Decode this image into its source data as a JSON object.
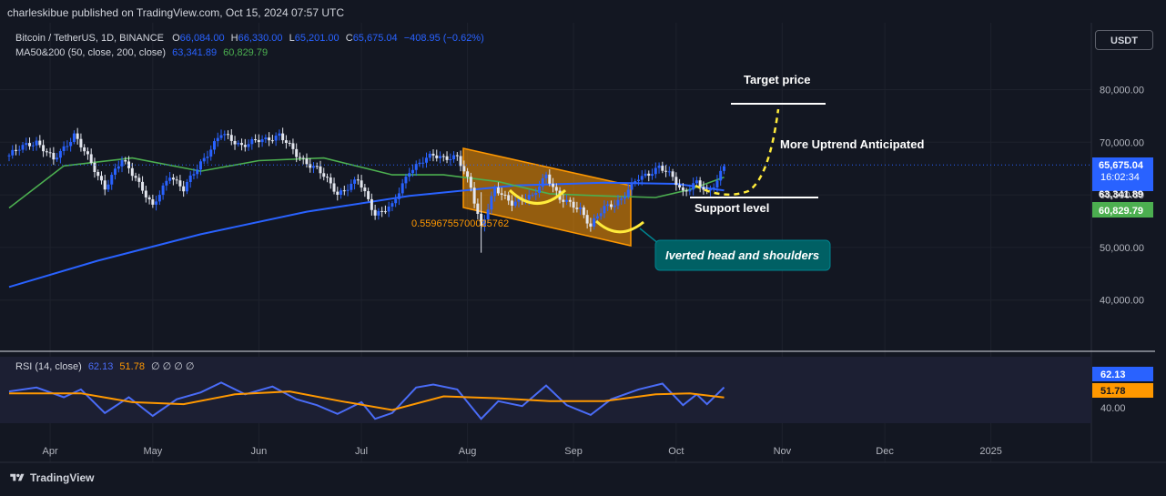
{
  "header": {
    "publisher": "charleskibue published on TradingView.com, Oct 15, 2024 07:57 UTC"
  },
  "legend": {
    "symbol": "Bitcoin / TetherUS, 1D, BINANCE",
    "open_k": "O",
    "open_v": "66,084.00",
    "high_k": "H",
    "high_v": "66,330.00",
    "low_k": "L",
    "low_v": "65,201.00",
    "close_k": "C",
    "close_v": "65,675.04",
    "change": "−408.95 (−0.62%)",
    "ma_label": "MA50&200 (50, close, 200, close)",
    "ma50_value": "63,341.89",
    "ma200_value": "60,829.79",
    "rsi_label": "RSI (14, close)",
    "rsi_value": "62.13",
    "rsi_ma_value": "51.78",
    "rsi_extra": "∅ ∅ ∅ ∅"
  },
  "currency_button": "USDT",
  "footer": {
    "brand": "TradingView"
  },
  "colors": {
    "background": "#131722",
    "bull": "#2962ff",
    "ma50": "#4caf50",
    "ma200": "#2962ff",
    "rsi": "#4a6cf7",
    "rsi_ma": "#ff9800",
    "channel": "#ff9800",
    "arc": "#ffeb3b",
    "callout": "#006064"
  },
  "chart_data": {
    "type": "candlestick",
    "y_axis": {
      "ticks": [
        "80,000.00",
        "70,000.00",
        "60,000.00",
        "50,000.00",
        "40,000.00"
      ],
      "tick_values": [
        80000,
        70000,
        60000,
        50000,
        40000
      ],
      "range": [
        35000,
        85000
      ]
    },
    "x_axis": {
      "ticks": [
        "Apr",
        "May",
        "Jun",
        "Jul",
        "Aug",
        "Sep",
        "Oct",
        "Nov",
        "Dec",
        "2025"
      ],
      "tick_dates": [
        "2024-04-01",
        "2024-05-01",
        "2024-06-01",
        "2024-07-01",
        "2024-08-01",
        "2024-09-01",
        "2024-10-01",
        "2024-11-01",
        "2024-12-01",
        "2025-01-01"
      ],
      "range": [
        "2024-03-20",
        "2025-01-20"
      ]
    },
    "price_series": [
      [
        "2024-03-20",
        67500
      ],
      [
        "2024-03-25",
        69500
      ],
      [
        "2024-03-28",
        70200
      ],
      [
        "2024-04-02",
        66500
      ],
      [
        "2024-04-08",
        71500
      ],
      [
        "2024-04-12",
        67000
      ],
      [
        "2024-04-17",
        61500
      ],
      [
        "2024-04-22",
        66500
      ],
      [
        "2024-04-26",
        63500
      ],
      [
        "2024-05-01",
        57500
      ],
      [
        "2024-05-06",
        64000
      ],
      [
        "2024-05-10",
        60900
      ],
      [
        "2024-05-15",
        66200
      ],
      [
        "2024-05-21",
        71500
      ],
      [
        "2024-05-27",
        69500
      ],
      [
        "2024-06-03",
        70500
      ],
      [
        "2024-06-07",
        71500
      ],
      [
        "2024-06-12",
        67500
      ],
      [
        "2024-06-18",
        65000
      ],
      [
        "2024-06-24",
        60300
      ],
      [
        "2024-06-30",
        62700
      ],
      [
        "2024-07-05",
        56500
      ],
      [
        "2024-07-10",
        57700
      ],
      [
        "2024-07-15",
        64800
      ],
      [
        "2024-07-22",
        67500
      ],
      [
        "2024-07-29",
        67000
      ],
      [
        "2024-08-02",
        61500
      ],
      [
        "2024-08-05",
        54000
      ],
      [
        "2024-08-09",
        60900
      ],
      [
        "2024-08-14",
        58700
      ],
      [
        "2024-08-20",
        59500
      ],
      [
        "2024-08-24",
        64100
      ],
      [
        "2024-08-28",
        59000
      ],
      [
        "2024-09-03",
        57500
      ],
      [
        "2024-09-06",
        53900
      ],
      [
        "2024-09-10",
        57600
      ],
      [
        "2024-09-15",
        59200
      ],
      [
        "2024-09-20",
        63200
      ],
      [
        "2024-09-26",
        65200
      ],
      [
        "2024-09-30",
        63300
      ],
      [
        "2024-10-03",
        60700
      ],
      [
        "2024-10-07",
        62200
      ],
      [
        "2024-10-10",
        60300
      ],
      [
        "2024-10-13",
        63000
      ],
      [
        "2024-10-15",
        65675
      ]
    ],
    "ma50_series": [
      [
        "2024-03-20",
        57500
      ],
      [
        "2024-04-05",
        65500
      ],
      [
        "2024-04-25",
        67000
      ],
      [
        "2024-05-15",
        64500
      ],
      [
        "2024-06-01",
        66500
      ],
      [
        "2024-06-20",
        67000
      ],
      [
        "2024-07-10",
        63800
      ],
      [
        "2024-07-25",
        63800
      ],
      [
        "2024-08-10",
        62500
      ],
      [
        "2024-08-25",
        60200
      ],
      [
        "2024-09-10",
        59800
      ],
      [
        "2024-09-25",
        59500
      ],
      [
        "2024-10-05",
        61000
      ],
      [
        "2024-10-15",
        63341.89
      ]
    ],
    "ma200_series": [
      [
        "2024-03-20",
        42500
      ],
      [
        "2024-04-15",
        47500
      ],
      [
        "2024-05-15",
        52500
      ],
      [
        "2024-06-15",
        56800
      ],
      [
        "2024-07-15",
        59800
      ],
      [
        "2024-08-15",
        61800
      ],
      [
        "2024-09-10",
        62300
      ],
      [
        "2024-10-01",
        62100
      ],
      [
        "2024-10-15",
        60829.79
      ]
    ],
    "rsi": {
      "label": "RSI (14, close)",
      "tick": "40.00",
      "tick_value": 40,
      "range": [
        20,
        85
      ],
      "rsi_series": [
        [
          "2024-03-20",
          58
        ],
        [
          "2024-03-28",
          62
        ],
        [
          "2024-04-05",
          52
        ],
        [
          "2024-04-10",
          60
        ],
        [
          "2024-04-17",
          36
        ],
        [
          "2024-04-24",
          52
        ],
        [
          "2024-05-01",
          33
        ],
        [
          "2024-05-08",
          50
        ],
        [
          "2024-05-15",
          57
        ],
        [
          "2024-05-21",
          67
        ],
        [
          "2024-05-28",
          55
        ],
        [
          "2024-06-05",
          63
        ],
        [
          "2024-06-12",
          50
        ],
        [
          "2024-06-18",
          44
        ],
        [
          "2024-06-24",
          35
        ],
        [
          "2024-07-01",
          47
        ],
        [
          "2024-07-05",
          30
        ],
        [
          "2024-07-10",
          36
        ],
        [
          "2024-07-17",
          62
        ],
        [
          "2024-07-22",
          65
        ],
        [
          "2024-07-29",
          60
        ],
        [
          "2024-08-05",
          30
        ],
        [
          "2024-08-10",
          48
        ],
        [
          "2024-08-17",
          43
        ],
        [
          "2024-08-24",
          64
        ],
        [
          "2024-08-30",
          44
        ],
        [
          "2024-09-06",
          34
        ],
        [
          "2024-09-12",
          50
        ],
        [
          "2024-09-20",
          60
        ],
        [
          "2024-09-27",
          66
        ],
        [
          "2024-10-03",
          44
        ],
        [
          "2024-10-07",
          55
        ],
        [
          "2024-10-10",
          45
        ],
        [
          "2024-10-15",
          62.13
        ]
      ],
      "rsi_ma_series": [
        [
          "2024-03-20",
          56
        ],
        [
          "2024-04-10",
          56
        ],
        [
          "2024-04-25",
          47
        ],
        [
          "2024-05-10",
          45
        ],
        [
          "2024-05-25",
          55
        ],
        [
          "2024-06-10",
          58
        ],
        [
          "2024-06-25",
          48
        ],
        [
          "2024-07-10",
          39
        ],
        [
          "2024-07-25",
          53
        ],
        [
          "2024-08-10",
          51
        ],
        [
          "2024-08-25",
          48
        ],
        [
          "2024-09-10",
          48
        ],
        [
          "2024-09-25",
          55
        ],
        [
          "2024-10-05",
          56
        ],
        [
          "2024-10-15",
          51.78
        ]
      ],
      "value_label": "62.13",
      "ma_value_label": "51.78"
    },
    "price_labels": [
      {
        "text": "65,675.04",
        "sub": "16:02:34",
        "color": "#2962ff"
      },
      {
        "text": "63,341.89",
        "color": "#2962ff"
      },
      {
        "text": "60,829.79",
        "color": "#4caf50"
      }
    ],
    "annotations": {
      "target": "Target price",
      "uptrend": "More Uptrend Anticipated",
      "support": "Support level",
      "callout": "Iverted head and shoulders",
      "fib": "0.5596755700025762"
    }
  }
}
